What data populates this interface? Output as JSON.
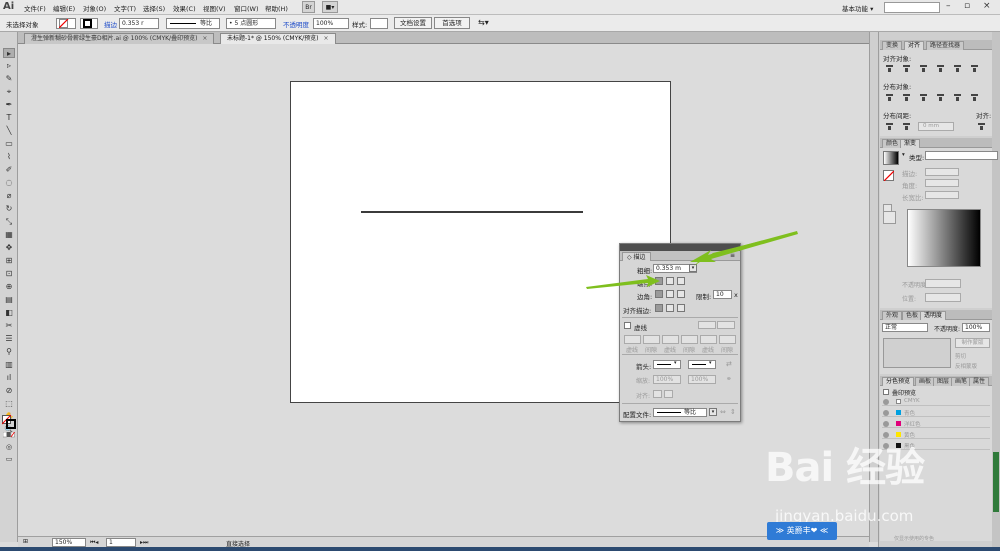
{
  "app": {
    "logo": "Ai"
  },
  "menu": [
    "文件(F)",
    "编辑(E)",
    "对象(O)",
    "文字(T)",
    "选择(S)",
    "效果(C)",
    "视图(V)",
    "窗口(W)",
    "帮助(H)"
  ],
  "menu_extra": {
    "br": "Br",
    "mode": "■▾"
  },
  "workspace": "基本功能 ▾",
  "control": {
    "selection": "未选择对象",
    "stroke_label": "描边",
    "stroke_value": "0.353 r",
    "profile": "等比",
    "brush": "5 点圆形",
    "opacity_label": "不透明度",
    "opacity_value": "100%",
    "style_label": "样式:",
    "doc_setup": "文档设置",
    "prefs": "首选项"
  },
  "tabs": [
    {
      "label": "澄生弹新糊砂骨薪绿生豪D相片.ai @ 100% (CMYK/叠印预览)",
      "close": "×"
    },
    {
      "label": "未标题-1* @ 150% (CMYK/预览)",
      "close": "×"
    }
  ],
  "tools": [
    "▸",
    "▹",
    "✎",
    "⌖",
    "✒",
    "T",
    "╲",
    "▭",
    "⌇",
    "✐",
    "◌",
    "⌀",
    "↻",
    "⤡",
    "▦",
    "✥",
    "⊞",
    "⊡",
    "⊕",
    "▤",
    "◧",
    "✂",
    "☰",
    "⚲",
    "▥",
    "ıl",
    "⊘",
    "⬚",
    "✋",
    "🔍"
  ],
  "status": {
    "zoom": "150%",
    "page": "1",
    "tool": "直接选择"
  },
  "stroke_panel": {
    "tab": "◇ 描边",
    "weight_label": "粗细:",
    "weight_value": "0.353 m",
    "cap_label": "端点:",
    "corner_label": "边角:",
    "limit_label": "限制:",
    "limit_value": "10",
    "limit_unit": "x",
    "align_label": "对齐描边:",
    "dashed_label": "虚线",
    "dash_labels": [
      "虚线",
      "间隙",
      "虚线",
      "间隙",
      "虚线",
      "间隙"
    ],
    "arrow_label": "箭头:",
    "scale_label": "缩放:",
    "scale_start": "100%",
    "scale_end": "100%",
    "align_arrow_label": "对齐:",
    "profile_label": "配置文件:",
    "profile_value": "等比"
  },
  "panels": {
    "align_tabs": [
      "变换",
      "对齐",
      "路径查找器"
    ],
    "align_objects": "对齐对象:",
    "distribute_objects": "分布对象:",
    "distribute_spacing": "分布间距:",
    "spacing_value": "0 mm",
    "align_to": "对齐:",
    "gradient_tabs": [
      "颜色",
      "渐变"
    ],
    "gradient_type": "类型:",
    "gradient_stroke": "描边:",
    "gradient_angle": "角度:",
    "gradient_ratio": "长宽比:",
    "gradient_opacity": "不透明度:",
    "gradient_position": "位置:",
    "transparency_tabs": [
      "外观",
      "色板",
      "透明度"
    ],
    "blend_mode": "正常",
    "opacity_label": "不透明度:",
    "opacity_value": "100%",
    "make_mask": "制作蒙版",
    "clip": "剪切",
    "invert_mask": "反相蒙版",
    "sep_tabs": [
      "分色预览",
      "画板",
      "图层",
      "画笔",
      "属性"
    ],
    "overprint": "叠印预览",
    "separations": [
      {
        "name": "CMYK",
        "color": "#ffffff"
      },
      {
        "name": "青色",
        "color": "#00a0e0"
      },
      {
        "name": "洋红色",
        "color": "#e0007a"
      },
      {
        "name": "黄色",
        "color": "#ffe600"
      },
      {
        "name": "黑色",
        "color": "#111111"
      }
    ],
    "use_spot": "仅显示使用的专色"
  },
  "watermark": {
    "logo": "Bai 经验",
    "url": "jingyan.baidu.com",
    "badge": "≫ 英爵丰❤ ≪"
  }
}
